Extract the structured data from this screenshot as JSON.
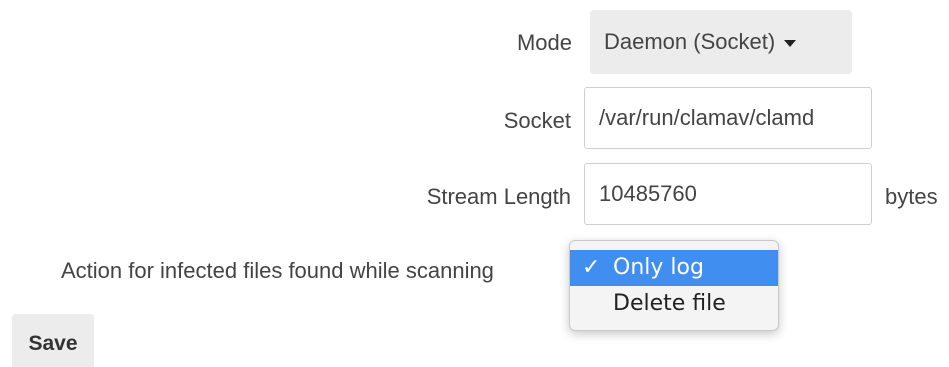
{
  "form": {
    "mode": {
      "label": "Mode",
      "selected": "Daemon (Socket)"
    },
    "socket": {
      "label": "Socket",
      "value": "/var/run/clamav/clamd"
    },
    "stream_length": {
      "label": "Stream Length",
      "value": "10485760",
      "unit": "bytes"
    },
    "infected_action": {
      "label": "Action for infected files found while scanning",
      "options": [
        {
          "label": "Only log",
          "checked": true,
          "check_mark": "✓"
        },
        {
          "label": "Delete file",
          "checked": false
        }
      ]
    }
  },
  "actions": {
    "save_label": "Save"
  },
  "colors": {
    "highlight": "#3f8ef0",
    "button_bg": "#ececec"
  }
}
